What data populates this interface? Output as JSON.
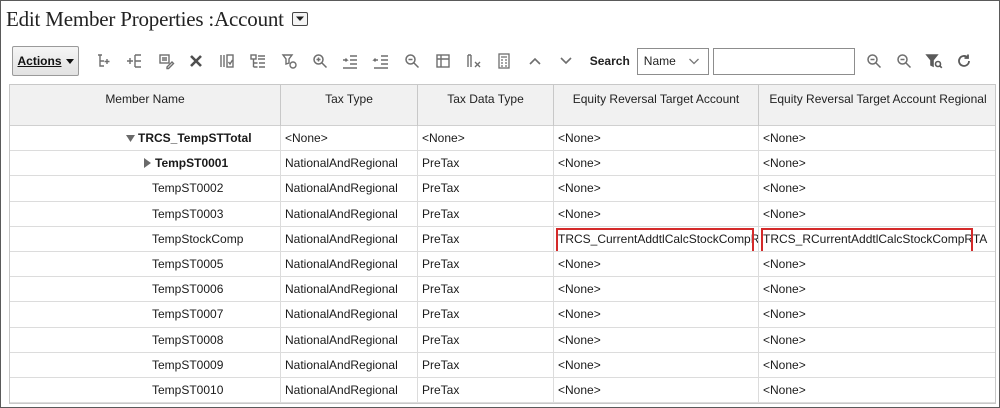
{
  "title": "Edit Member Properties :Account",
  "toolbar": {
    "actions_label": "Actions",
    "search_label": "Search",
    "search_by": "Name",
    "search_value": "",
    "icons_left": [
      "add-child-icon",
      "add-sibling-icon",
      "edit-member-icon",
      "delete-icon",
      "columns-icon",
      "expand-all-icon",
      "filter-list-icon",
      "zoom-in-icon",
      "indent-icon",
      "outdent-icon",
      "zoom-out-icon",
      "freeze-icon",
      "clear-filter-icon",
      "calculator-icon",
      "chevron-up-icon",
      "chevron-down-icon"
    ],
    "icons_right": [
      "search-next-icon",
      "search-prev-icon",
      "filter-search-icon",
      "refresh-icon"
    ]
  },
  "grid": {
    "columns": [
      "Member Name",
      "Tax Type",
      "Tax Data Type",
      "Equity Reversal Target Account",
      "Equity Reversal Target Account Regional"
    ],
    "rows": [
      {
        "name": "TRCS_TempSTTotal",
        "level": 1,
        "expand": "expanded",
        "bold": true,
        "tax_type": "<None>",
        "tax_data_type": "<None>",
        "equity": "<None>",
        "equity_regional": "<None>",
        "highlight": false
      },
      {
        "name": "TempST0001",
        "level": 2,
        "expand": "collapsed",
        "bold": true,
        "tax_type": "NationalAndRegional",
        "tax_data_type": "PreTax",
        "equity": "<None>",
        "equity_regional": "<None>",
        "highlight": false
      },
      {
        "name": "TempST0002",
        "level": 3,
        "expand": "none",
        "bold": false,
        "tax_type": "NationalAndRegional",
        "tax_data_type": "PreTax",
        "equity": "<None>",
        "equity_regional": "<None>",
        "highlight": false
      },
      {
        "name": "TempST0003",
        "level": 3,
        "expand": "none",
        "bold": false,
        "tax_type": "NationalAndRegional",
        "tax_data_type": "PreTax",
        "equity": "<None>",
        "equity_regional": "<None>",
        "highlight": false
      },
      {
        "name": "TempStockComp",
        "level": 3,
        "expand": "none",
        "bold": false,
        "tax_type": "NationalAndRegional",
        "tax_data_type": "PreTax",
        "equity": "TRCS_CurrentAddtlCalcStockCompRTA",
        "equity_regional": "TRCS_RCurrentAddtlCalcStockCompRTA",
        "highlight": true
      },
      {
        "name": "TempST0005",
        "level": 3,
        "expand": "none",
        "bold": false,
        "tax_type": "NationalAndRegional",
        "tax_data_type": "PreTax",
        "equity": "<None>",
        "equity_regional": "<None>",
        "highlight": false
      },
      {
        "name": "TempST0006",
        "level": 3,
        "expand": "none",
        "bold": false,
        "tax_type": "NationalAndRegional",
        "tax_data_type": "PreTax",
        "equity": "<None>",
        "equity_regional": "<None>",
        "highlight": false
      },
      {
        "name": "TempST0007",
        "level": 3,
        "expand": "none",
        "bold": false,
        "tax_type": "NationalAndRegional",
        "tax_data_type": "PreTax",
        "equity": "<None>",
        "equity_regional": "<None>",
        "highlight": false
      },
      {
        "name": "TempST0008",
        "level": 3,
        "expand": "none",
        "bold": false,
        "tax_type": "NationalAndRegional",
        "tax_data_type": "PreTax",
        "equity": "<None>",
        "equity_regional": "<None>",
        "highlight": false
      },
      {
        "name": "TempST0009",
        "level": 3,
        "expand": "none",
        "bold": false,
        "tax_type": "NationalAndRegional",
        "tax_data_type": "PreTax",
        "equity": "<None>",
        "equity_regional": "<None>",
        "highlight": false
      },
      {
        "name": "TempST0010",
        "level": 3,
        "expand": "none",
        "bold": false,
        "tax_type": "NationalAndRegional",
        "tax_data_type": "PreTax",
        "equity": "<None>",
        "equity_regional": "<None>",
        "highlight": false
      }
    ]
  },
  "colors": {
    "highlight_border": "#d42a2a",
    "header_bg": "#f1f1f1",
    "icon_gray": "#6e6e6e"
  }
}
